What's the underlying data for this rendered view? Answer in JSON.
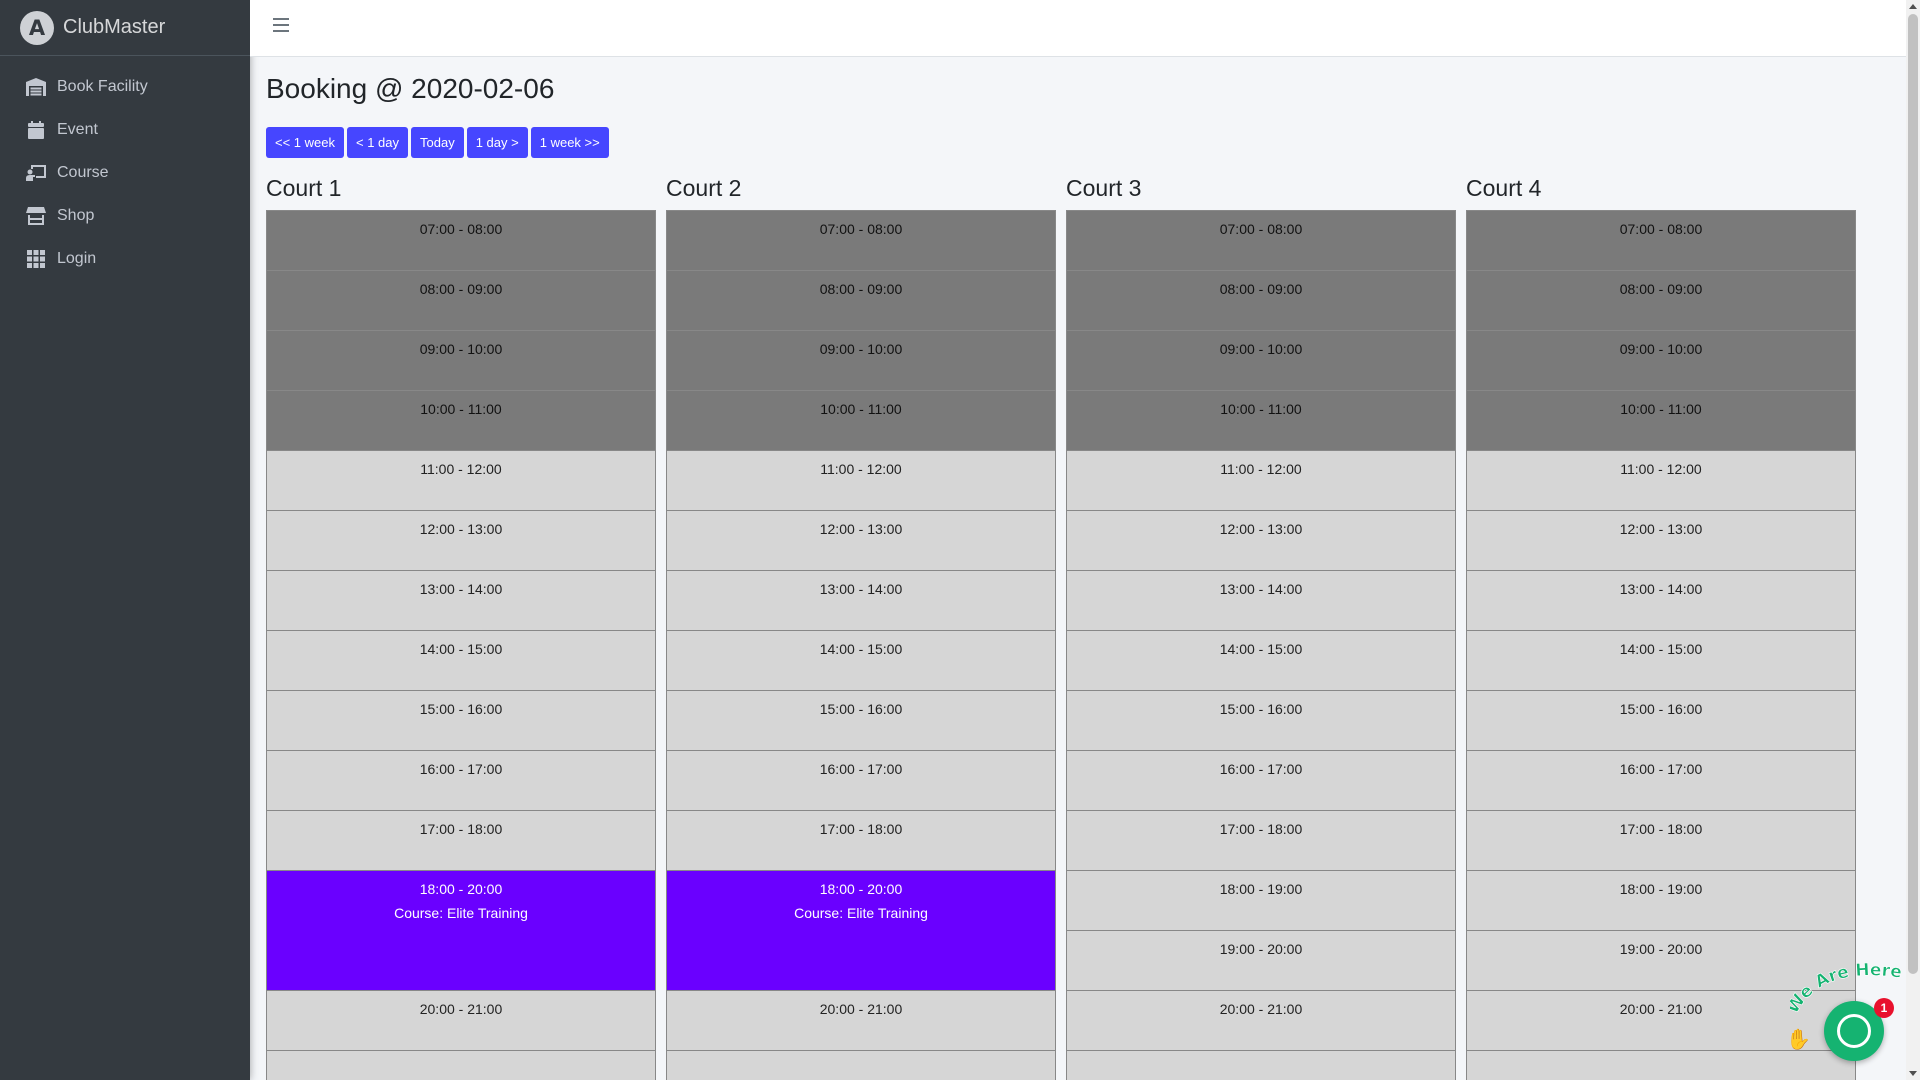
{
  "brand": {
    "logo_letter": "A",
    "name": "ClubMaster"
  },
  "sidebar": {
    "items": [
      {
        "label": "Book Facility",
        "icon": "warehouse-icon"
      },
      {
        "label": "Event",
        "icon": "calendar-icon"
      },
      {
        "label": "Course",
        "icon": "chalkboard-teacher-icon"
      },
      {
        "label": "Shop",
        "icon": "store-icon"
      },
      {
        "label": "Login",
        "icon": "grid-icon"
      }
    ]
  },
  "page": {
    "title": "Booking @ 2020-02-06"
  },
  "nav_buttons": {
    "prev_week": "<< 1 week",
    "prev_day": "< 1 day",
    "today": "Today",
    "next_day": "1 day >",
    "next_week": "1 week >>"
  },
  "courts": [
    {
      "name": "Court 1",
      "slots": [
        {
          "time": "07:00 - 08:00",
          "state": "past",
          "label": ""
        },
        {
          "time": "08:00 - 09:00",
          "state": "past",
          "label": ""
        },
        {
          "time": "09:00 - 10:00",
          "state": "past",
          "label": ""
        },
        {
          "time": "10:00 - 11:00",
          "state": "past",
          "label": ""
        },
        {
          "time": "11:00 - 12:00",
          "state": "open",
          "label": ""
        },
        {
          "time": "12:00 - 13:00",
          "state": "open",
          "label": ""
        },
        {
          "time": "13:00 - 14:00",
          "state": "open",
          "label": ""
        },
        {
          "time": "14:00 - 15:00",
          "state": "open",
          "label": ""
        },
        {
          "time": "15:00 - 16:00",
          "state": "open",
          "label": ""
        },
        {
          "time": "16:00 - 17:00",
          "state": "open",
          "label": ""
        },
        {
          "time": "17:00 - 18:00",
          "state": "open",
          "label": ""
        },
        {
          "time": "18:00 - 20:00",
          "state": "course",
          "label": "Course: Elite Training"
        },
        {
          "time": "20:00 - 21:00",
          "state": "open",
          "label": ""
        },
        {
          "time": "",
          "state": "open",
          "label": ""
        }
      ]
    },
    {
      "name": "Court 2",
      "slots": [
        {
          "time": "07:00 - 08:00",
          "state": "past",
          "label": ""
        },
        {
          "time": "08:00 - 09:00",
          "state": "past",
          "label": ""
        },
        {
          "time": "09:00 - 10:00",
          "state": "past",
          "label": ""
        },
        {
          "time": "10:00 - 11:00",
          "state": "past",
          "label": ""
        },
        {
          "time": "11:00 - 12:00",
          "state": "open",
          "label": ""
        },
        {
          "time": "12:00 - 13:00",
          "state": "open",
          "label": ""
        },
        {
          "time": "13:00 - 14:00",
          "state": "open",
          "label": ""
        },
        {
          "time": "14:00 - 15:00",
          "state": "open",
          "label": ""
        },
        {
          "time": "15:00 - 16:00",
          "state": "open",
          "label": ""
        },
        {
          "time": "16:00 - 17:00",
          "state": "open",
          "label": ""
        },
        {
          "time": "17:00 - 18:00",
          "state": "open",
          "label": ""
        },
        {
          "time": "18:00 - 20:00",
          "state": "course",
          "label": "Course: Elite Training"
        },
        {
          "time": "20:00 - 21:00",
          "state": "open",
          "label": ""
        },
        {
          "time": "",
          "state": "open",
          "label": ""
        }
      ]
    },
    {
      "name": "Court 3",
      "slots": [
        {
          "time": "07:00 - 08:00",
          "state": "past",
          "label": ""
        },
        {
          "time": "08:00 - 09:00",
          "state": "past",
          "label": ""
        },
        {
          "time": "09:00 - 10:00",
          "state": "past",
          "label": ""
        },
        {
          "time": "10:00 - 11:00",
          "state": "past",
          "label": ""
        },
        {
          "time": "11:00 - 12:00",
          "state": "open",
          "label": ""
        },
        {
          "time": "12:00 - 13:00",
          "state": "open",
          "label": ""
        },
        {
          "time": "13:00 - 14:00",
          "state": "open",
          "label": ""
        },
        {
          "time": "14:00 - 15:00",
          "state": "open",
          "label": ""
        },
        {
          "time": "15:00 - 16:00",
          "state": "open",
          "label": ""
        },
        {
          "time": "16:00 - 17:00",
          "state": "open",
          "label": ""
        },
        {
          "time": "17:00 - 18:00",
          "state": "open",
          "label": ""
        },
        {
          "time": "18:00 - 19:00",
          "state": "open",
          "label": ""
        },
        {
          "time": "19:00 - 20:00",
          "state": "open",
          "label": ""
        },
        {
          "time": "20:00 - 21:00",
          "state": "open",
          "label": ""
        },
        {
          "time": "",
          "state": "open",
          "label": ""
        }
      ]
    },
    {
      "name": "Court 4",
      "slots": [
        {
          "time": "07:00 - 08:00",
          "state": "past",
          "label": ""
        },
        {
          "time": "08:00 - 09:00",
          "state": "past",
          "label": ""
        },
        {
          "time": "09:00 - 10:00",
          "state": "past",
          "label": ""
        },
        {
          "time": "10:00 - 11:00",
          "state": "past",
          "label": ""
        },
        {
          "time": "11:00 - 12:00",
          "state": "open",
          "label": ""
        },
        {
          "time": "12:00 - 13:00",
          "state": "open",
          "label": ""
        },
        {
          "time": "13:00 - 14:00",
          "state": "open",
          "label": ""
        },
        {
          "time": "14:00 - 15:00",
          "state": "open",
          "label": ""
        },
        {
          "time": "15:00 - 16:00",
          "state": "open",
          "label": ""
        },
        {
          "time": "16:00 - 17:00",
          "state": "open",
          "label": ""
        },
        {
          "time": "17:00 - 18:00",
          "state": "open",
          "label": ""
        },
        {
          "time": "18:00 - 19:00",
          "state": "open",
          "label": ""
        },
        {
          "time": "19:00 - 20:00",
          "state": "open",
          "label": ""
        },
        {
          "time": "20:00 - 21:00",
          "state": "open",
          "label": ""
        },
        {
          "time": "",
          "state": "open",
          "label": ""
        }
      ]
    }
  ],
  "chat": {
    "banner": "We Are Here!",
    "badge_count": "1"
  },
  "colors": {
    "sidebar_bg": "#343a40",
    "button": "#4646ff",
    "course_slot": "#6a00ff",
    "past_slot": "#7a7a7a",
    "open_slot": "#d6d6d6",
    "chat_green": "#15b371"
  }
}
